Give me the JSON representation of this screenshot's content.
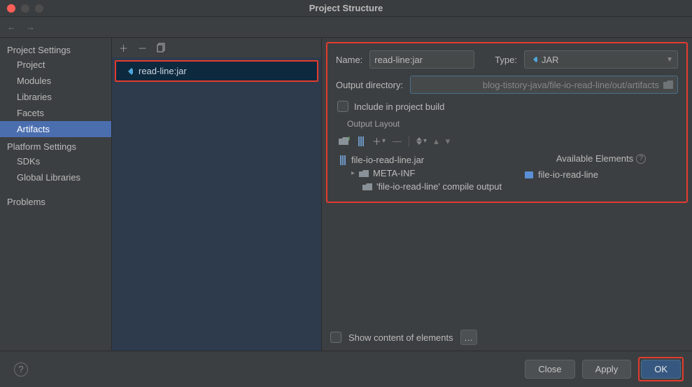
{
  "title": "Project Structure",
  "sidebar": {
    "groups": [
      {
        "label": "Project Settings",
        "items": [
          "Project",
          "Modules",
          "Libraries",
          "Facets",
          "Artifacts"
        ]
      },
      {
        "label": "Platform Settings",
        "items": [
          "SDKs",
          "Global Libraries"
        ]
      },
      {
        "label": "",
        "items": [
          "Problems"
        ]
      }
    ],
    "active": "Artifacts"
  },
  "artifactList": {
    "selected": "read-line:jar"
  },
  "form": {
    "nameLabel": "Name:",
    "nameValue": "read-line:jar",
    "typeLabel": "Type:",
    "typeValue": "JAR",
    "outdirLabel": "Output directory:",
    "outdirValue": "blog-tistory-java/file-io-read-line/out/artifacts",
    "includeLabel": "Include in project build",
    "outputLayoutLabel": "Output Layout",
    "availableLabel": "Available Elements",
    "tree": {
      "root": "file-io-read-line.jar",
      "meta": "META-INF",
      "compile": "'file-io-read-line' compile output"
    },
    "availModule": "file-io-read-line",
    "showContentLabel": "Show content of elements"
  },
  "buttons": {
    "close": "Close",
    "apply": "Apply",
    "ok": "OK"
  }
}
